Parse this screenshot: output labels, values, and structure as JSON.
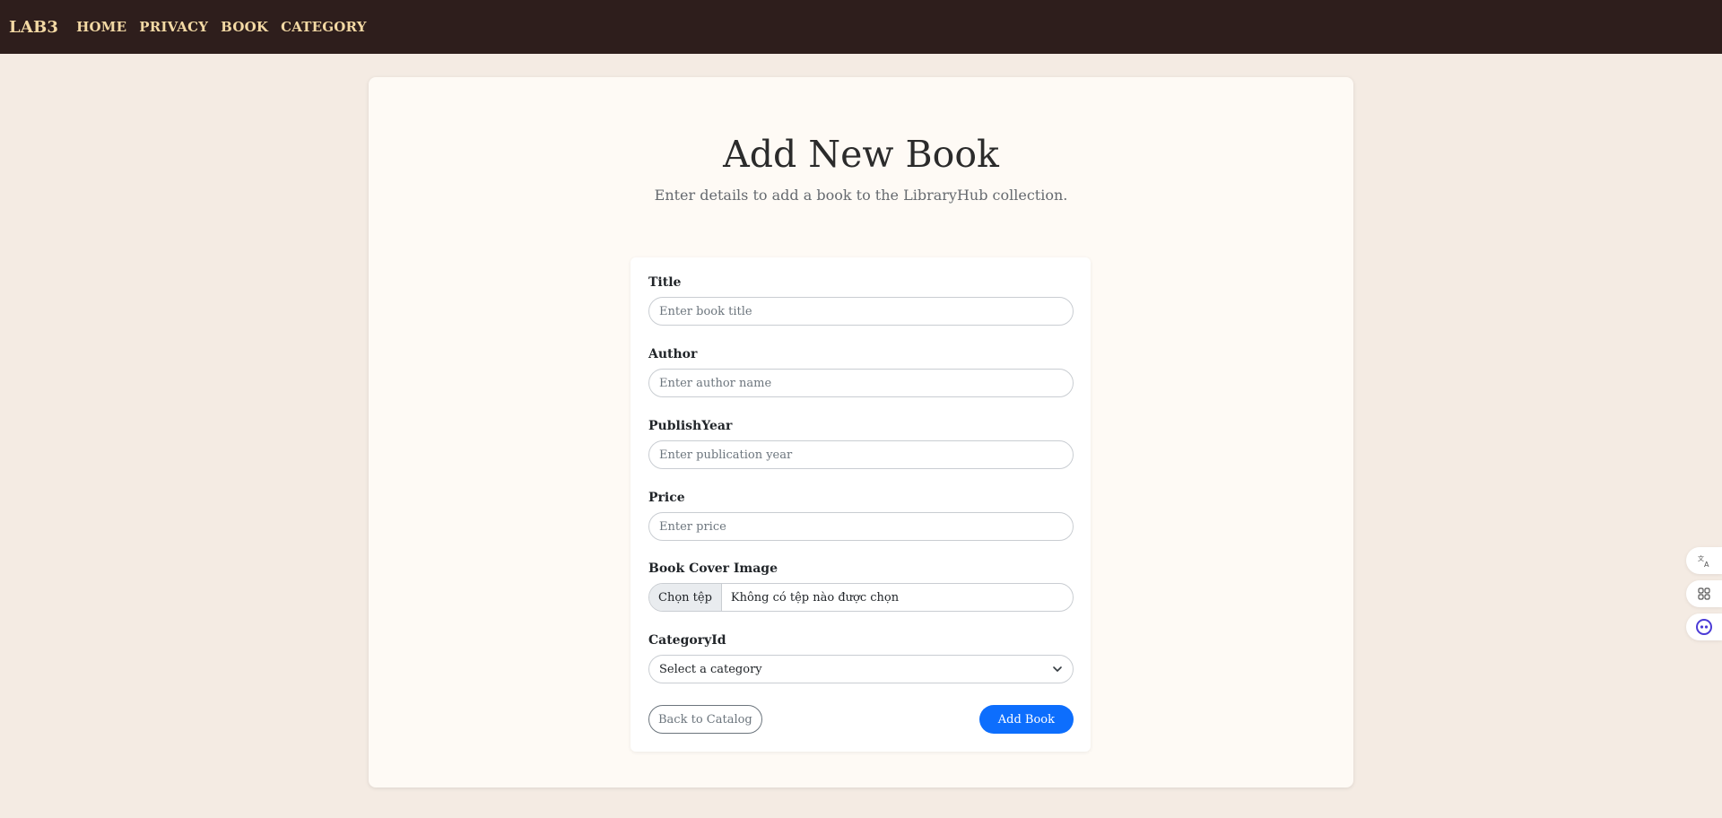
{
  "navbar": {
    "brand": "LAB3",
    "links": [
      "HOME",
      "PRIVACY",
      "BOOK",
      "CATEGORY"
    ]
  },
  "page": {
    "title": "Add New Book",
    "subtitle": "Enter details to add a book to the LibraryHub collection."
  },
  "form": {
    "title": {
      "label": "Title",
      "placeholder": "Enter book title"
    },
    "author": {
      "label": "Author",
      "placeholder": "Enter author name"
    },
    "publish_year": {
      "label": "PublishYear",
      "placeholder": "Enter publication year"
    },
    "price": {
      "label": "Price",
      "placeholder": "Enter price"
    },
    "cover": {
      "label": "Book Cover Image",
      "button": "Chọn tệp",
      "status": "Không có tệp nào được chọn"
    },
    "category": {
      "label": "CategoryId",
      "selected": "Select a category"
    },
    "back_label": "Back to Catalog",
    "submit_label": "Add Book"
  },
  "side_tools": [
    "translate-icon",
    "apps-grid-icon",
    "assistant-icon"
  ],
  "colors": {
    "navbar": "#2e1e1c",
    "nav_text": "#f3d9a4",
    "page_bg": "#f4ebe3",
    "card_bg": "#fefaf5",
    "primary": "#0d6efd",
    "secondary": "#6c757d"
  }
}
